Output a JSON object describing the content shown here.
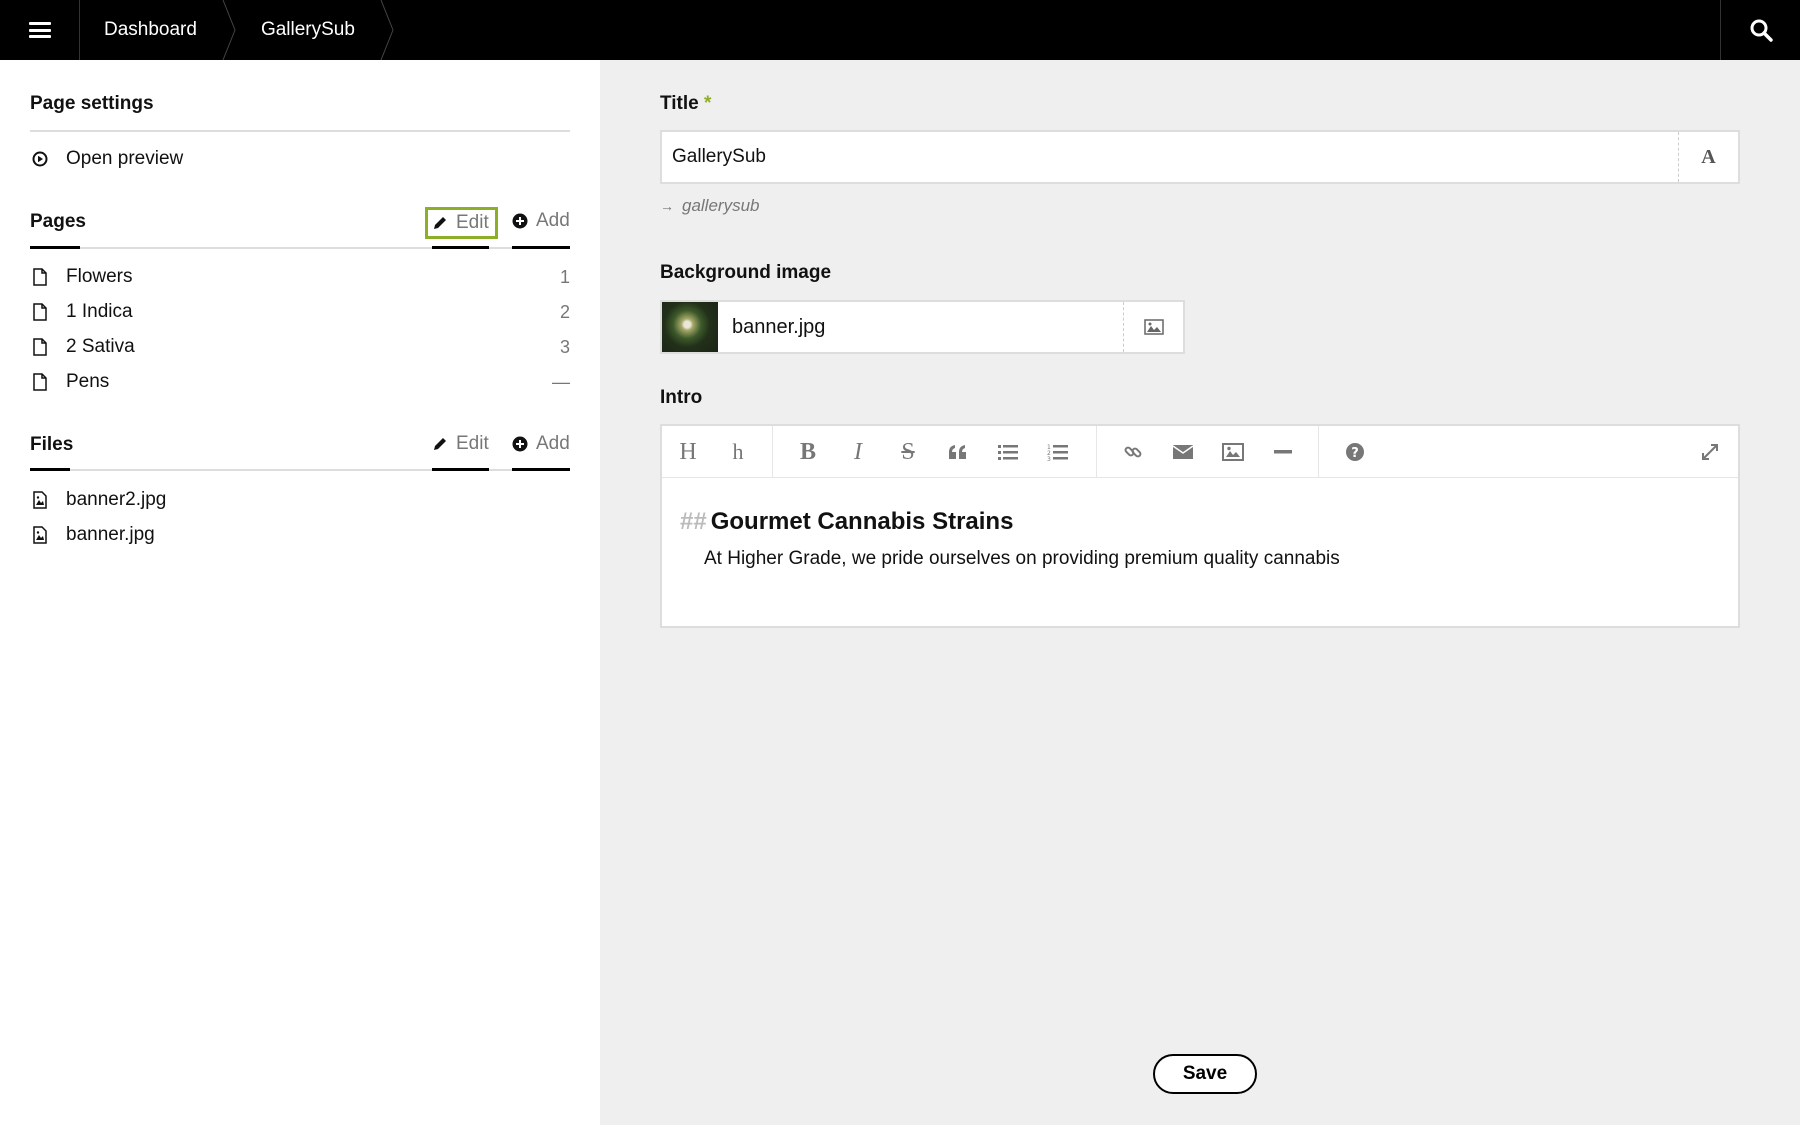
{
  "topbar": {
    "breadcrumbs": [
      "Dashboard",
      "GallerySub"
    ],
    "menu_icon": "hamburger-icon",
    "search_icon": "search-icon"
  },
  "sidebar": {
    "page_settings_title": "Page settings",
    "open_preview_label": "Open preview",
    "pages": {
      "title": "Pages",
      "edit_label": "Edit",
      "add_label": "Add",
      "items": [
        {
          "label": "Flowers",
          "num": "1"
        },
        {
          "label": "1 Indica",
          "num": "2"
        },
        {
          "label": "2 Sativa",
          "num": "3"
        },
        {
          "label": "Pens",
          "num": "—"
        }
      ]
    },
    "files": {
      "title": "Files",
      "edit_label": "Edit",
      "add_label": "Add",
      "items": [
        {
          "label": "banner2.jpg"
        },
        {
          "label": "banner.jpg"
        }
      ]
    }
  },
  "form": {
    "title_label": "Title",
    "required_mark": "*",
    "title_value": "GallerySub",
    "title_addon": "A",
    "slug": "gallerysub",
    "bg_label": "Background image",
    "bg_filename": "banner.jpg",
    "intro_label": "Intro",
    "intro_heading_marker": "##",
    "intro_heading": "Gourmet Cannabis Strains",
    "intro_text": "At Higher Grade, we pride ourselves on providing premium quality cannabis",
    "toolbar_heading1": "H",
    "toolbar_heading2": "h",
    "toolbar_bold": "B",
    "toolbar_italic": "I",
    "toolbar_strike": "S",
    "save_label": "Save"
  },
  "colors": {
    "accent": "#8dae28",
    "topbar_bg": "#000000",
    "main_bg": "#efefef"
  }
}
